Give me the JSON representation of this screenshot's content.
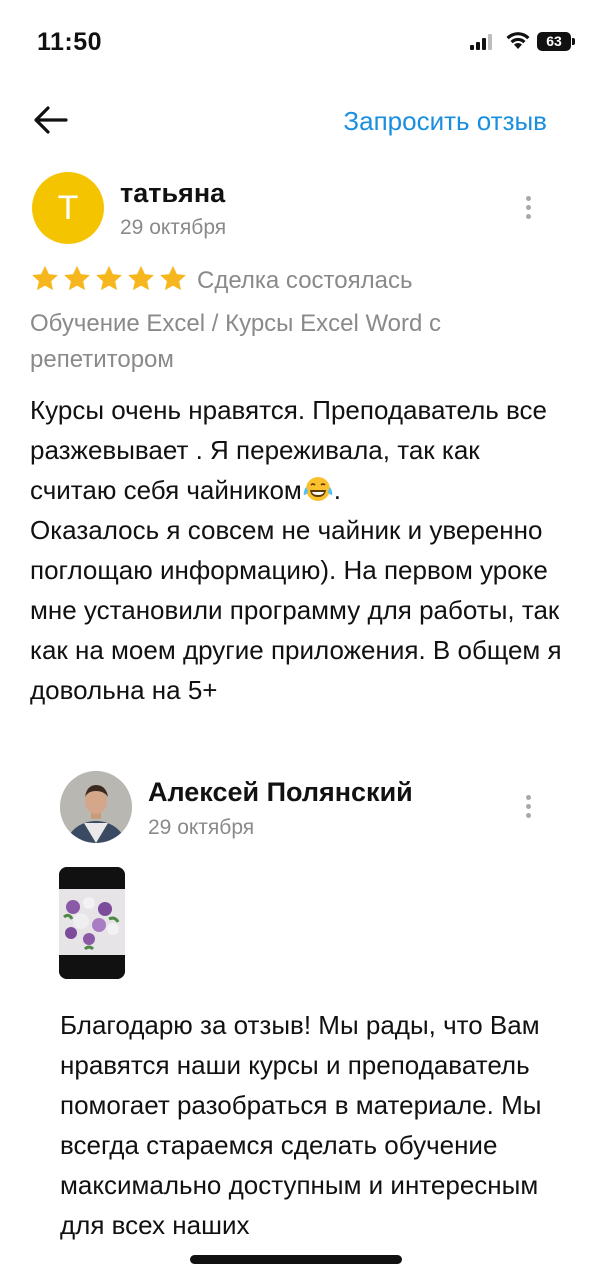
{
  "status_bar": {
    "time": "11:50",
    "battery": "63"
  },
  "nav": {
    "request_review_label": "Запросить отзыв"
  },
  "review": {
    "avatar_letter": "Т",
    "avatar_color": "#f5c400",
    "author": "татьяна",
    "date": "29 октября",
    "rating": 5,
    "deal_status": "Сделка состоялась",
    "course": "Обучение Excel / Курсы Excel Word с репетитором",
    "text_before_emoji": "Курсы очень нравятся. Преподаватель все разжевывает . Я переживала, так как считаю себя чайником",
    "emoji": "face-with-tears-of-joy-icon",
    "text_after_emoji": ".\nОказалось я совсем не чайник и уверенно поглощаю информацию). На первом уроке мне установили программу для работы, так как на моем другие приложения. В общем я довольна на 5+"
  },
  "reply": {
    "author": "Алексей Полянский",
    "date": "29 октября",
    "text": "Благодарю за отзыв! Мы рады, что Вам нравятся наши курсы и преподаватель помогает разобраться в материале. Мы всегда стараемся сделать обучение максимально доступным и интересным для всех наших"
  },
  "colors": {
    "accent": "#1a8fe0",
    "star": "#f6b61e",
    "muted": "#8a8a8a"
  }
}
